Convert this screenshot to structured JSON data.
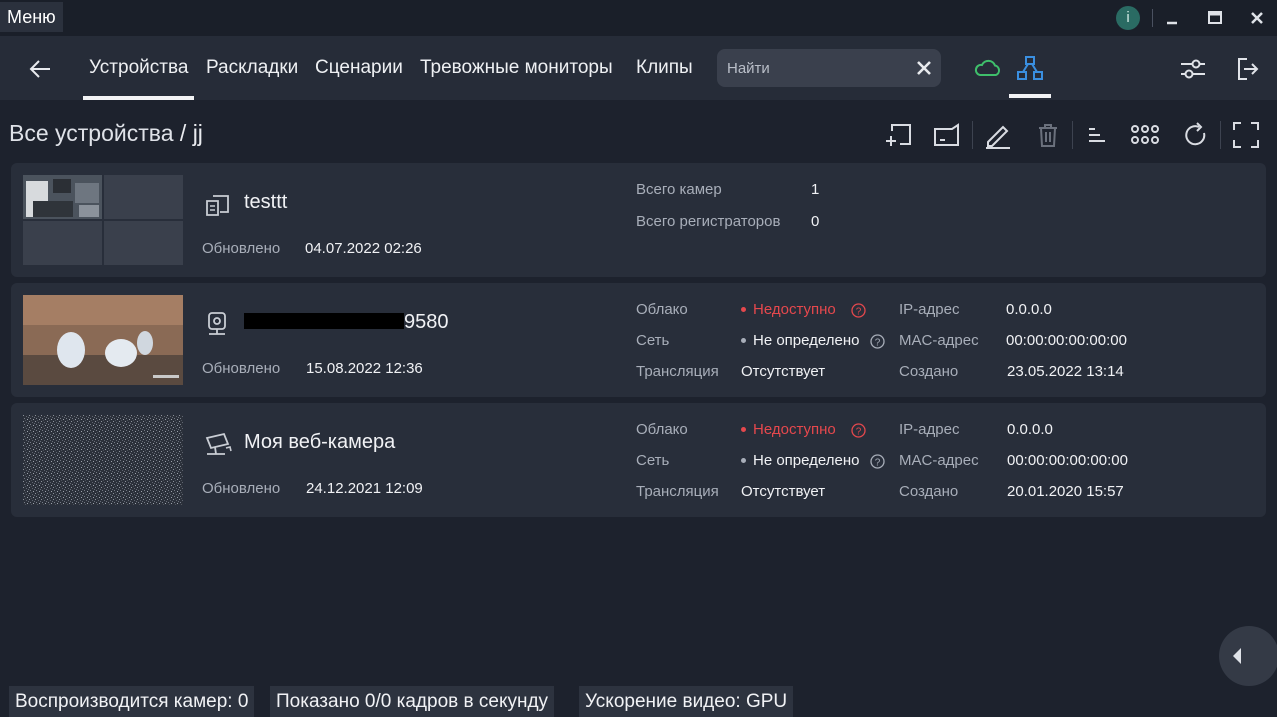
{
  "titlebar": {
    "menu_label": "Меню",
    "info_icon_label": "i",
    "controls": [
      "minimize-icon",
      "maximize-icon",
      "close-icon"
    ]
  },
  "nav": {
    "tabs": [
      {
        "label": "Устройства",
        "active": true
      },
      {
        "label": "Раскладки",
        "active": false
      },
      {
        "label": "Сценарии",
        "active": false
      },
      {
        "label": "Тревожные мониторы",
        "active": false
      },
      {
        "label": "Клипы",
        "active": false
      }
    ],
    "search": {
      "placeholder": "Найти",
      "value": ""
    },
    "icons": [
      "back-arrow-icon",
      "cloud-icon",
      "topology-icon",
      "settings-sliders-icon",
      "logout-icon"
    ],
    "colors": {
      "cloud": "#3fbf6b",
      "topology": "#3a8fe0"
    }
  },
  "breadcrumb": {
    "root": "Все устройства",
    "separator": "/",
    "current": "jj"
  },
  "toolbar": {
    "icons": [
      "add-device-icon",
      "device-icon",
      "edit-icon",
      "delete-icon",
      "sort-icon",
      "grid-view-icon",
      "refresh-icon",
      "fullscreen-icon"
    ]
  },
  "devices": [
    {
      "type": "group",
      "name": "testtt",
      "updated_label": "Обновлено",
      "updated": "04.07.2022 02:26",
      "stats": [
        {
          "label": "Всего камер",
          "value": "1"
        },
        {
          "label": "Всего регистраторов",
          "value": "0"
        }
      ]
    },
    {
      "type": "camera",
      "name_suffix": "9580",
      "updated_label": "Обновлено",
      "updated": "15.08.2022 12:36",
      "cloud_label": "Облако",
      "cloud": "Недоступно",
      "network_label": "Сеть",
      "network": "Не определено",
      "stream_label": "Трансляция",
      "stream": "Отсутствует",
      "ip_label": "IP-адрес",
      "ip": "0.0.0.0",
      "mac_label": "MAC-адрес",
      "mac": "00:00:00:00:00:00",
      "created_label": "Создано",
      "created": "23.05.2022 13:14"
    },
    {
      "type": "webcam",
      "name": "Моя веб-камера",
      "updated_label": "Обновлено",
      "updated": "24.12.2021 12:09",
      "cloud_label": "Облако",
      "cloud": "Недоступно",
      "network_label": "Сеть",
      "network": "Не определено",
      "stream_label": "Трансляция",
      "stream": "Отсутствует",
      "ip_label": "IP-адрес",
      "ip": "0.0.0.0",
      "mac_label": "MAC-адрес",
      "mac": "00:00:00:00:00:00",
      "created_label": "Создано",
      "created": "20.01.2020 15:57"
    }
  ],
  "status_bar": {
    "playing": "Воспроизводится камер: 0",
    "fps": "Показано 0/0 кадров в секунду",
    "accel": "Ускорение видео: GPU"
  },
  "colors": {
    "status_unavailable": "#e5484d",
    "status_unknown": "#a8aeb9"
  }
}
